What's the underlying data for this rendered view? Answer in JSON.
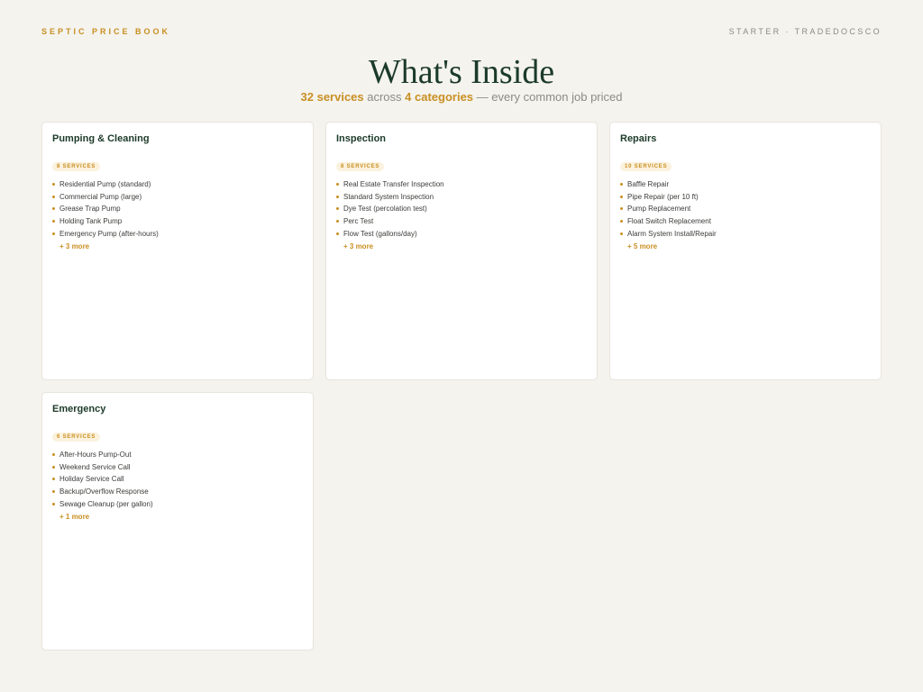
{
  "header": {
    "brand": "SEPTIC PRICE BOOK",
    "tier": "STARTER · TRADEDOCSCO"
  },
  "hero": {
    "title": "What's Inside",
    "services_count": "32 services",
    "across": " across ",
    "categories_count": "4 categories",
    "tagline": " — every common job priced"
  },
  "categories": [
    {
      "title": "Pumping & Cleaning",
      "badge": "8 SERVICES",
      "items": [
        "Residential Pump (standard)",
        "Commercial Pump (large)",
        "Grease Trap Pump",
        "Holding Tank Pump",
        "Emergency Pump (after-hours)"
      ],
      "more": "+ 3 more"
    },
    {
      "title": "Inspection",
      "badge": "8 SERVICES",
      "items": [
        "Real Estate Transfer Inspection",
        "Standard System Inspection",
        "Dye Test (percolation test)",
        "Perc Test",
        "Flow Test (gallons/day)"
      ],
      "more": "+ 3 more"
    },
    {
      "title": "Repairs",
      "badge": "10 SERVICES",
      "items": [
        "Baffle Repair",
        "Pipe Repair (per 10 ft)",
        "Pump Replacement",
        "Float Switch Replacement",
        "Alarm System Install/Repair"
      ],
      "more": "+ 5 more"
    },
    {
      "title": "Emergency",
      "badge": "6 SERVICES",
      "items": [
        "After-Hours Pump-Out",
        "Weekend Service Call",
        "Holiday Service Call",
        "Backup/Overflow Response",
        "Sewage Cleanup (per gallon)"
      ],
      "more": "+ 1 more"
    }
  ],
  "colors": {
    "accent": "#c98f22",
    "heading": "#1c3a29",
    "background": "#f4f3ee",
    "card": "#ffffff"
  }
}
